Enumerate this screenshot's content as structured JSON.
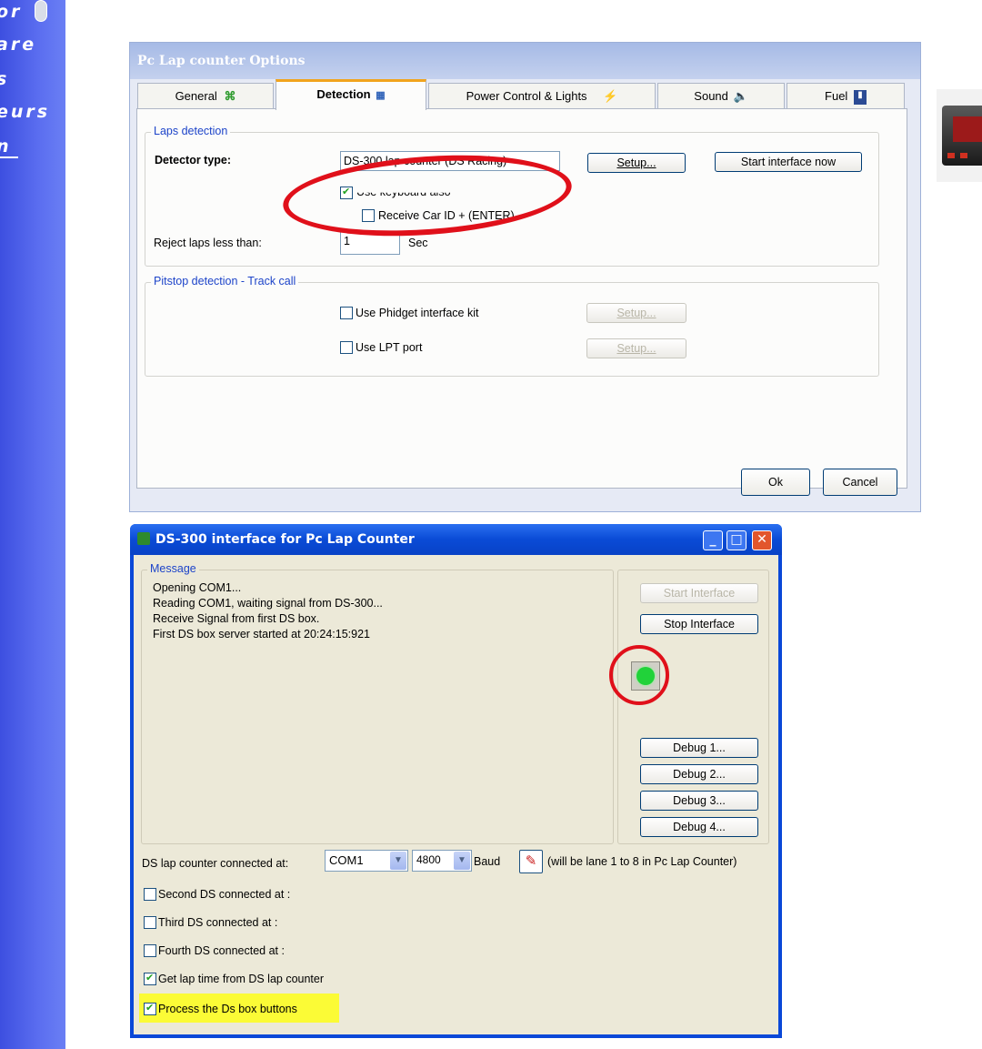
{
  "sidebar": {
    "fragments": [
      "or",
      "are",
      "s",
      "eurs",
      "n"
    ]
  },
  "options_dialog": {
    "title": "Pc Lap counter Options",
    "tabs": [
      {
        "label": "General",
        "icon": "grid-icon"
      },
      {
        "label": "Detection",
        "icon": "detection-icon",
        "active": true
      },
      {
        "label": "Power Control & Lights",
        "icon": "lightning-icon"
      },
      {
        "label": "Sound",
        "icon": "speaker-icon"
      },
      {
        "label": "Fuel",
        "icon": "fuel-pump-icon"
      }
    ],
    "laps_group": "Laps detection",
    "detector_type_label": "Detector type:",
    "detector_type_value": "DS-300 lap counter (DS Racing)",
    "setup_label": "Setup...",
    "start_interface_now_label": "Start interface now",
    "use_keyboard_label": "Use keyboard also",
    "receive_car_id_label": "Receive Car ID + (ENTER)",
    "reject_laps_label": "Reject laps less than:",
    "reject_laps_value": "1",
    "reject_laps_unit": "Sec",
    "pitstop_group": "Pitstop detection - Track call",
    "phidget_label": "Use Phidget  interface kit",
    "lpt_label": "Use LPT port",
    "ok_label": "Ok",
    "cancel_label": "Cancel"
  },
  "ds_dialog": {
    "title": "DS-300 interface for Pc Lap Counter",
    "message_group": "Message",
    "messages": [
      "Opening COM1...",
      "Reading COM1, waiting signal from DS-300...",
      "Receive Signal from first DS box.",
      "First DS box server started at 20:24:15:921"
    ],
    "start_interface_label": "Start Interface",
    "stop_interface_label": "Stop Interface",
    "debug_buttons": [
      "Debug 1...",
      "Debug 2...",
      "Debug 3...",
      "Debug 4..."
    ],
    "connected_label": "DS lap counter connected at:",
    "port_value": "COM1",
    "baud_value": "4800",
    "baud_label": "Baud",
    "lane_note": "(will be lane 1 to 8 in Pc Lap Counter)",
    "second_label": "Second DS connected at :",
    "third_label": "Third DS connected at :",
    "fourth_label": "Fourth DS connected at :",
    "get_lap_time_label": "Get lap time from DS lap counter",
    "process_buttons_label": "Process the Ds box buttons",
    "status_color": "#21d23a",
    "highlight_color": "#fbfb36",
    "annotation_color": "#e0101a"
  }
}
